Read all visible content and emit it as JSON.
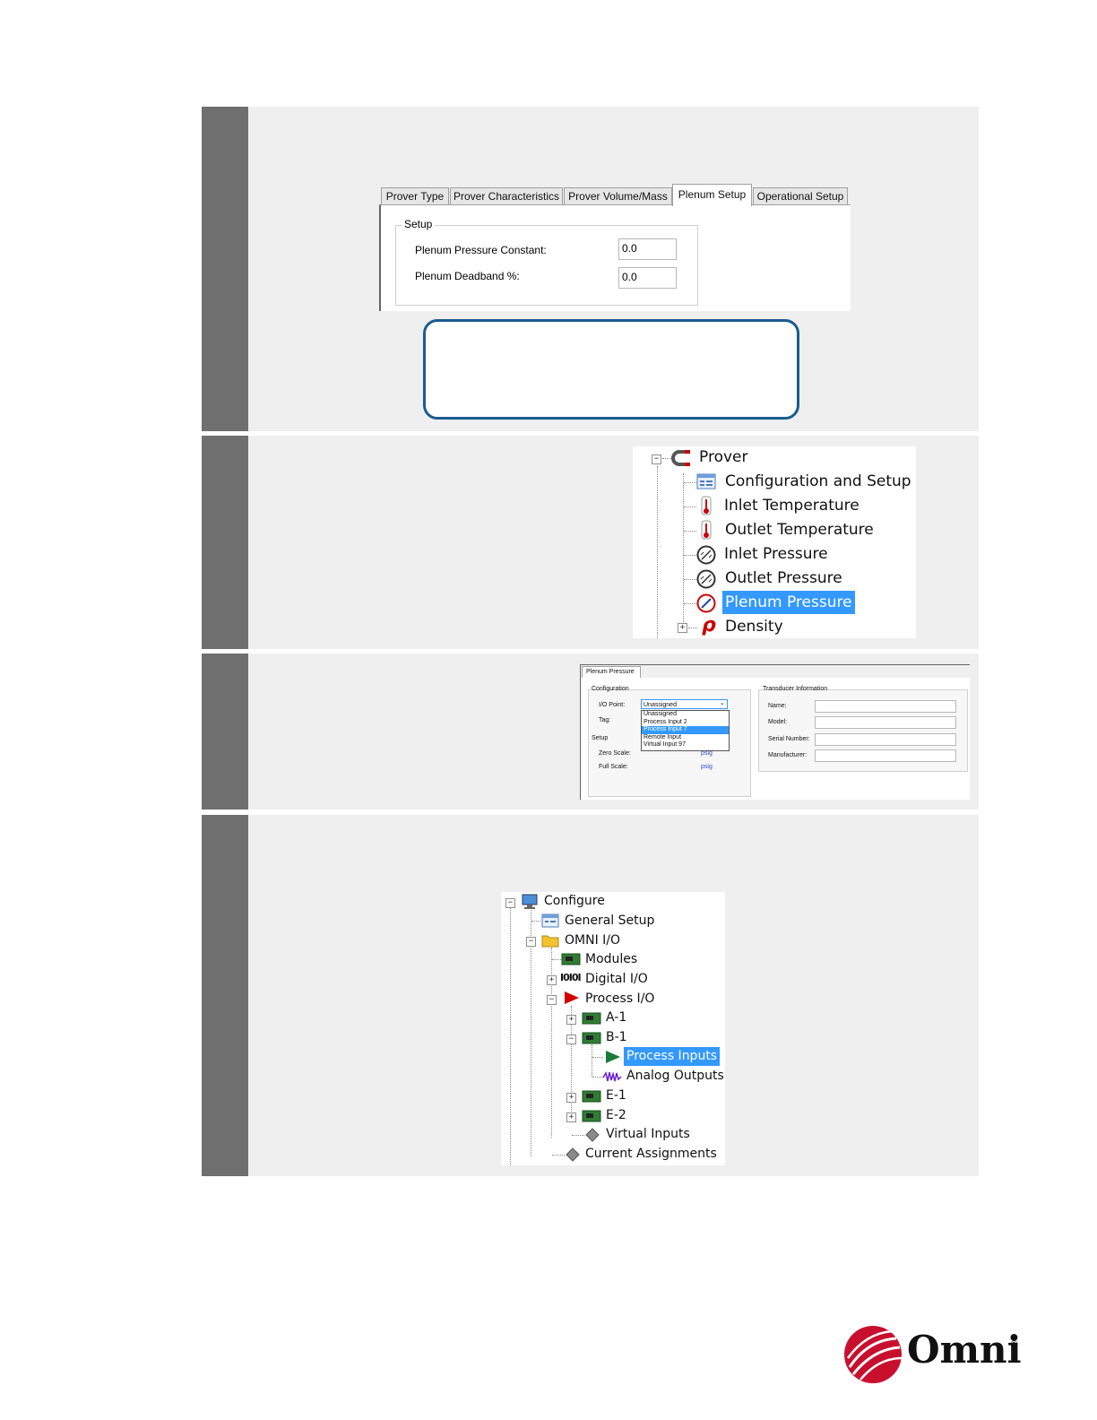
{
  "tabs": {
    "items": [
      "Prover Type",
      "Prover Characteristics",
      "Prover Volume/Mass",
      "Plenum Setup",
      "Operational Setup"
    ],
    "active": "Plenum Setup"
  },
  "plenum_setup": {
    "group_label": "Setup",
    "pressure_constant_label": "Plenum Pressure Constant:",
    "pressure_constant_value": "0.0",
    "deadband_label": "Plenum Deadband %:",
    "deadband_value": "0.0"
  },
  "prover_tree": {
    "root": "Prover",
    "items": [
      "Configuration and Setup",
      "Inlet Temperature",
      "Outlet Temperature",
      "Inlet Pressure",
      "Outlet Pressure",
      "Plenum Pressure",
      "Density"
    ],
    "selected": "Plenum Pressure"
  },
  "plenum_dialog": {
    "tab": "Plenum Pressure",
    "configuration_label": "Configuration",
    "io_point_label": "I/O Point:",
    "io_point_value": "Unassigned",
    "tag_label": "Tag:",
    "dropdown_options": [
      "Unassigned",
      "Process Input 2",
      "Process Input 7",
      "Remote Input",
      "Virtual Input 97"
    ],
    "dropdown_selected": "Process Input 7",
    "setup_label": "Setup",
    "zero_scale_label": "Zero Scale:",
    "full_scale_label": "Full Scale:",
    "unit": "psig",
    "transducer_label": "Transducer Information",
    "name_label": "Name:",
    "model_label": "Model:",
    "serial_label": "Serial Number:",
    "manufacturer_label": "Manufacturer:"
  },
  "configure_tree": {
    "root": "Configure",
    "general_setup": "General Setup",
    "omni_io": "OMNI I/O",
    "modules": "Modules",
    "digital_io": "Digital I/O",
    "process_io": "Process I/O",
    "a1": "A-1",
    "b1": "B-1",
    "process_inputs": "Process Inputs",
    "analog_outputs": "Analog Outputs",
    "e1": "E-1",
    "e2": "E-2",
    "virtual_inputs": "Virtual Inputs",
    "current_assignments": "Current Assignments"
  },
  "logo": {
    "text": "Omni",
    "registered": "®",
    "color": "#c8102e"
  }
}
